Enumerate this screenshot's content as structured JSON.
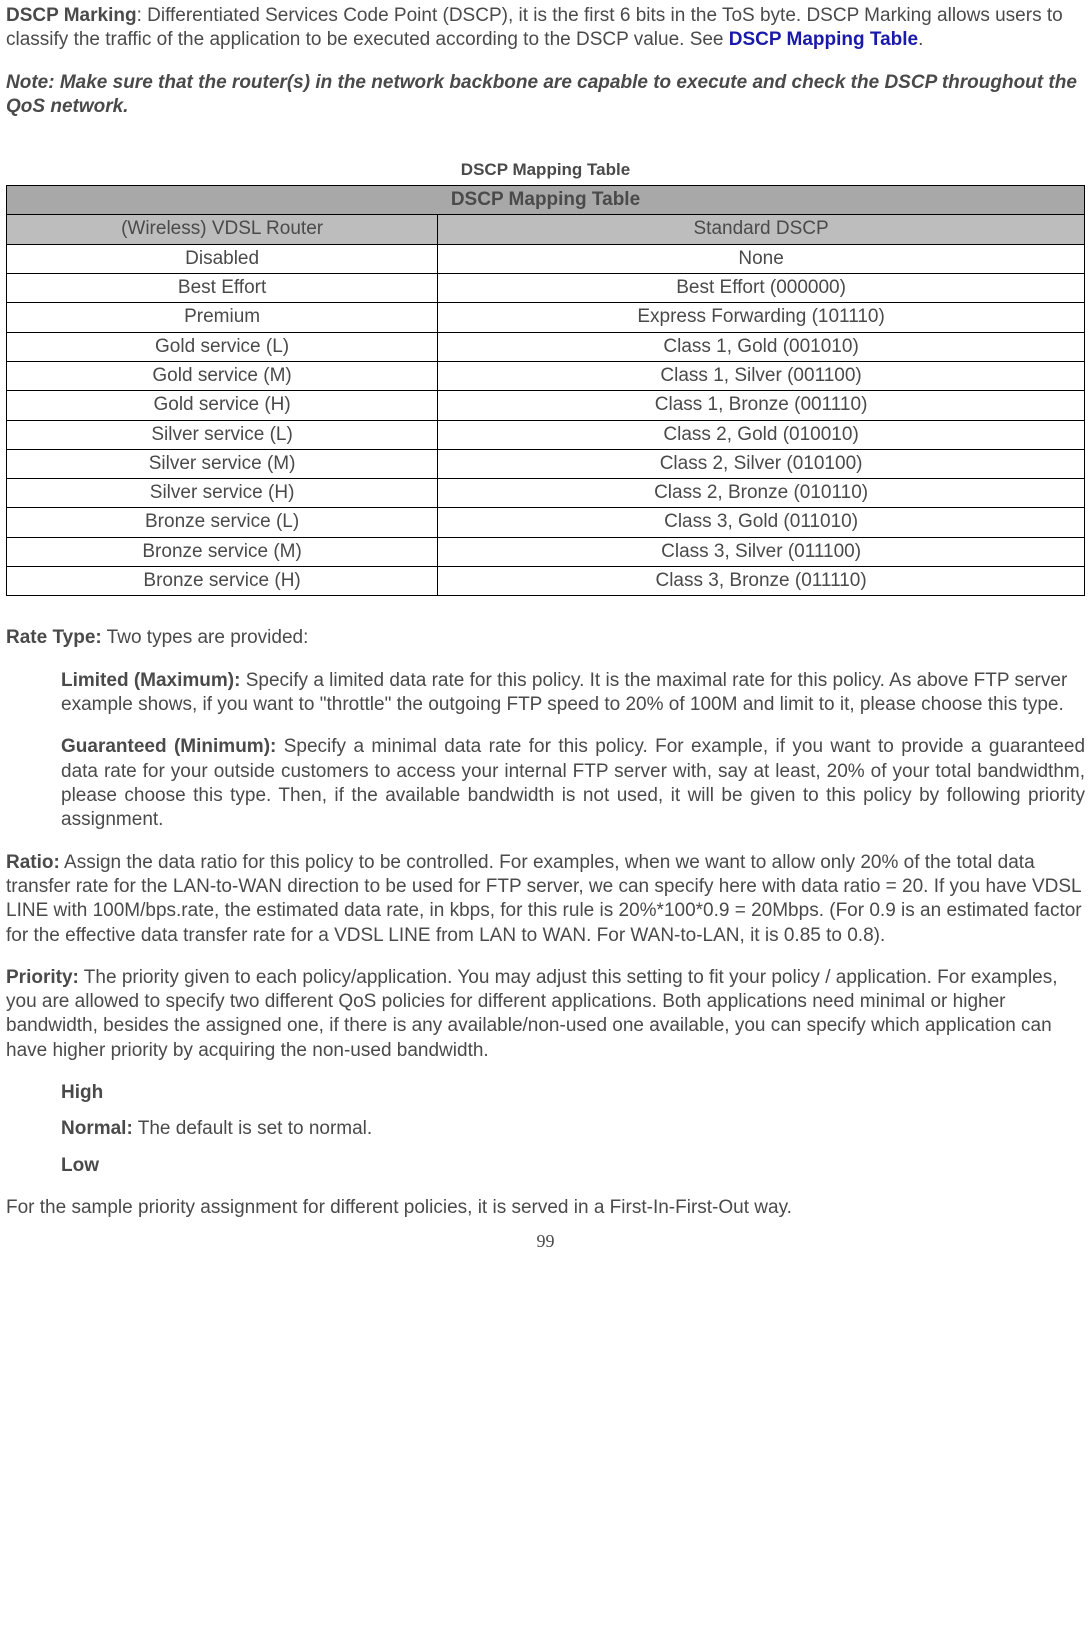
{
  "intro": {
    "dscp_label": "DSCP Marking",
    "dscp_text": ": Differentiated Services Code Point (DSCP), it is the first 6 bits in the ToS byte. DSCP Marking allows users to classify the traffic of the application to be executed according to the DSCP value.  See ",
    "dscp_link": "DSCP Mapping Table",
    "dscp_after": ".",
    "note": "Note: Make sure that the router(s) in the network backbone are capable to execute and check the DSCP throughout the QoS network."
  },
  "table": {
    "caption": "DSCP Mapping Table",
    "title": "DSCP Mapping Table",
    "col1": "(Wireless) VDSL Router",
    "col2": "Standard DSCP",
    "rows": [
      {
        "a": "Disabled",
        "b": "None"
      },
      {
        "a": "Best Effort",
        "b": "Best Effort (000000)"
      },
      {
        "a": "Premium",
        "b": "Express Forwarding (101110)"
      },
      {
        "a": "Gold service (L)",
        "b": "Class 1, Gold (001010)"
      },
      {
        "a": "Gold service (M)",
        "b": "Class 1, Silver (001100)"
      },
      {
        "a": "Gold service (H)",
        "b": "Class 1, Bronze (001110)"
      },
      {
        "a": "Silver service (L)",
        "b": "Class 2, Gold (010010)"
      },
      {
        "a": "Silver service (M)",
        "b": "Class 2, Silver (010100)"
      },
      {
        "a": "Silver service (H)",
        "b": "Class 2, Bronze (010110)"
      },
      {
        "a": "Bronze service (L)",
        "b": "Class 3, Gold (011010)"
      },
      {
        "a": "Bronze service (M)",
        "b": "Class 3, Silver (011100)"
      },
      {
        "a": "Bronze service (H)",
        "b": "Class 3, Bronze (011110)"
      }
    ]
  },
  "rate": {
    "label": "Rate Type:",
    "text": " Two types are provided:",
    "limited_label": "Limited (Maximum):",
    "limited_text": " Specify a limited data rate for this policy. It is the maximal rate for this policy. As above FTP server example shows, if you want to \"throttle\" the outgoing FTP speed to 20% of 100M and limit to it, please choose this type.",
    "guaranteed_label": "Guaranteed (Minimum):",
    "guaranteed_text": " Specify a minimal data rate for this policy. For example, if you want to provide a guaranteed data rate for your outside customers to access your internal FTP server with, say at least, 20% of your total bandwidthm, please choose this type. Then, if the available bandwidth is not used, it will be given to this policy by following priority assignment."
  },
  "ratio": {
    "label": "Ratio:",
    "text": " Assign the data ratio for this policy to be controlled.  For examples, when we want to allow only 20% of the total data transfer rate for the LAN-to-WAN direction to be used for FTP server, we can specify here with data ratio = 20. If you have VDSL LINE with 100M/bps.rate, the estimated data rate, in kbps, for this rule is 20%*100*0.9 = 20Mbps. (For 0.9 is an estimated factor for the effective data transfer rate for a VDSL LINE from LAN to WAN. For WAN-to-LAN, it is 0.85 to 0.8)."
  },
  "priority": {
    "label": "Priority:",
    "text": " The priority given to each policy/application. You may adjust this setting to fit your policy / application. For examples, you are allowed to specify two different QoS policies for different applications. Both applications need minimal or higher bandwidth, besides the assigned one, if there is any available/non-used one available, you can specify which application can have higher priority by acquiring the non-used bandwidth.",
    "high": "High",
    "normal_label": "Normal:",
    "normal_text": " The default is set to normal.",
    "low": "Low"
  },
  "footer": {
    "text": "For the sample priority assignment for different policies, it is served in a First-In-First-Out  way.",
    "page": "99"
  }
}
